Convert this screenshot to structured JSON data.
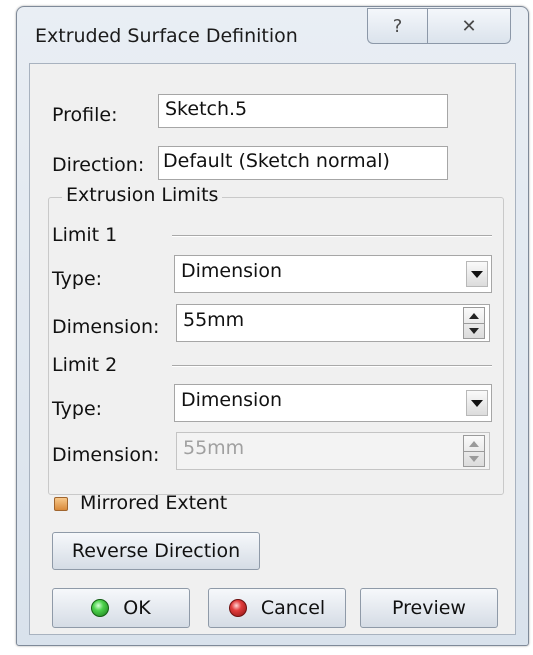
{
  "window": {
    "title": "Extruded Surface Definition",
    "help_glyph": "?",
    "close_glyph": "✕"
  },
  "profile": {
    "label": "Profile:",
    "value": "Sketch.5"
  },
  "direction": {
    "label": "Direction:",
    "value": "Default (Sketch normal)"
  },
  "extrusion_limits": {
    "legend": "Extrusion Limits",
    "limit1": {
      "header": "Limit 1",
      "type_label": "Type:",
      "type_value": "Dimension",
      "dimension_label": "Dimension:",
      "dimension_value": "55mm"
    },
    "limit2": {
      "header": "Limit 2",
      "type_label": "Type:",
      "type_value": "Dimension",
      "dimension_label": "Dimension:",
      "dimension_value": "55mm"
    }
  },
  "mirrored_extent": {
    "label": "Mirrored Extent"
  },
  "buttons": {
    "reverse_direction": "Reverse Direction",
    "ok": "OK",
    "cancel": "Cancel",
    "preview": "Preview"
  },
  "colors": {
    "ok_indicator": "#3cbf3c",
    "cancel_indicator": "#d63030",
    "checkbox": "#e9a557"
  }
}
